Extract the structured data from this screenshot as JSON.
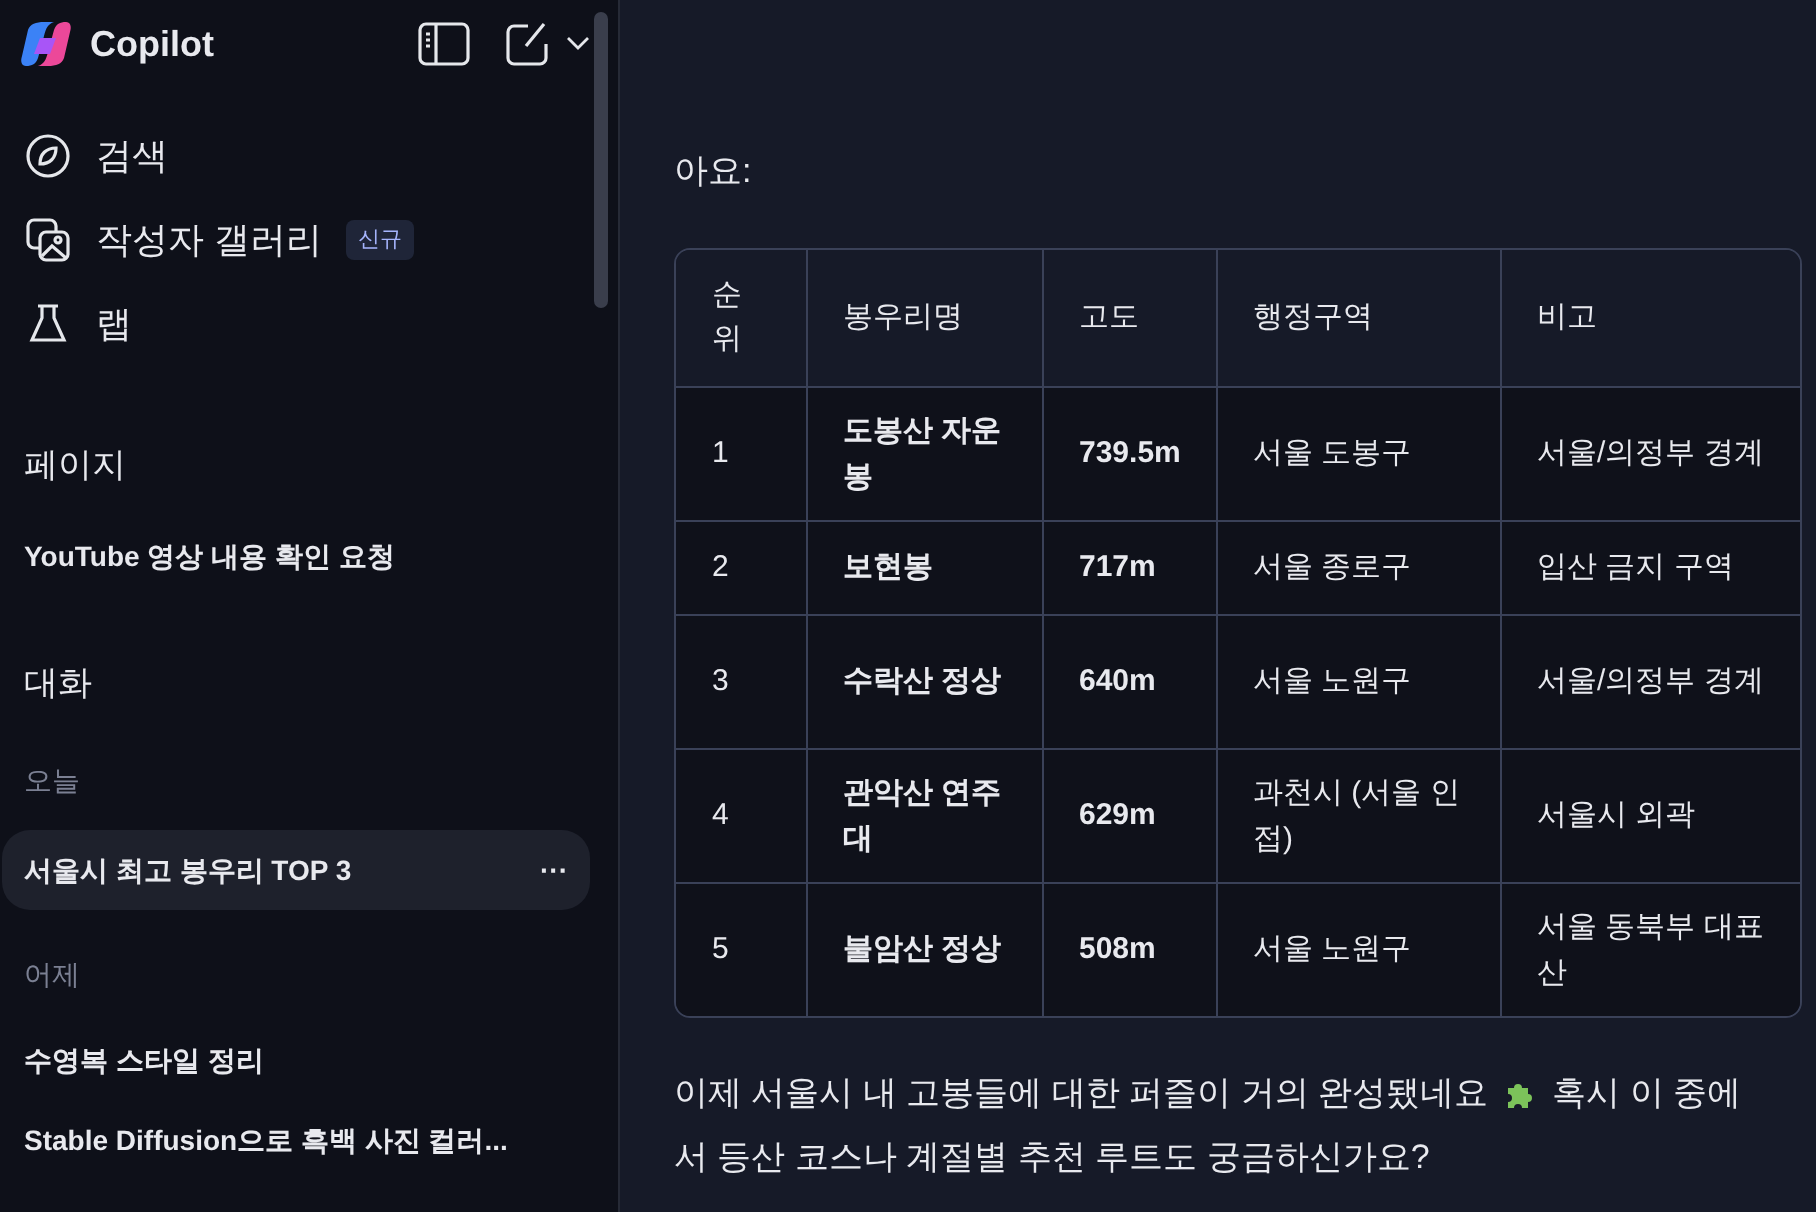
{
  "sidebar": {
    "brand": "Copilot",
    "nav": [
      {
        "kind": "search",
        "label": "검색"
      },
      {
        "kind": "gallery",
        "label": "작성자 갤러리",
        "badge": "신규"
      },
      {
        "kind": "lab",
        "label": "랩"
      }
    ],
    "pages_heading": "페이지",
    "pages": [
      "YouTube 영상 내용 확인 요청"
    ],
    "conversations_heading": "대화",
    "groups": [
      {
        "label": "오늘",
        "items": [
          {
            "title": "서울시 최고 봉우리 TOP 3",
            "selected": true,
            "more": "···"
          }
        ]
      },
      {
        "label": "어제",
        "items": [
          {
            "title": "수영복 스타일 정리",
            "selected": false
          },
          {
            "title": "Stable Diffusion으로 흑백 사진 컬러...",
            "selected": false
          }
        ]
      }
    ]
  },
  "chat": {
    "intro_tail": "아요:",
    "table": {
      "columns": [
        "순위",
        "봉우리명",
        "고도",
        "행정구역",
        "비고"
      ],
      "rows": [
        [
          "1",
          "도봉산 자운봉",
          "739.5m",
          "서울 도봉구",
          "서울/의정부 경계"
        ],
        [
          "2",
          "보현봉",
          "717m",
          "서울 종로구",
          "입산 금지 구역"
        ],
        [
          "3",
          "수락산 정상",
          "640m",
          "서울 노원구",
          "서울/의정부 경계"
        ],
        [
          "4",
          "관악산 연주대",
          "629m",
          "과천시 (서울 인접)",
          "서울시 외곽"
        ],
        [
          "5",
          "불암산 정상",
          "508m",
          "서울 노원구",
          "서울 동북부 대표 산"
        ]
      ]
    },
    "closing": [
      "이제 서울시 내 고봉들에 대한 퍼즐이 거의 완성됐네요",
      "혹시 이 중에",
      "서 등산 코스나 계절별 추천 루트도 궁금하신가요?"
    ]
  }
}
